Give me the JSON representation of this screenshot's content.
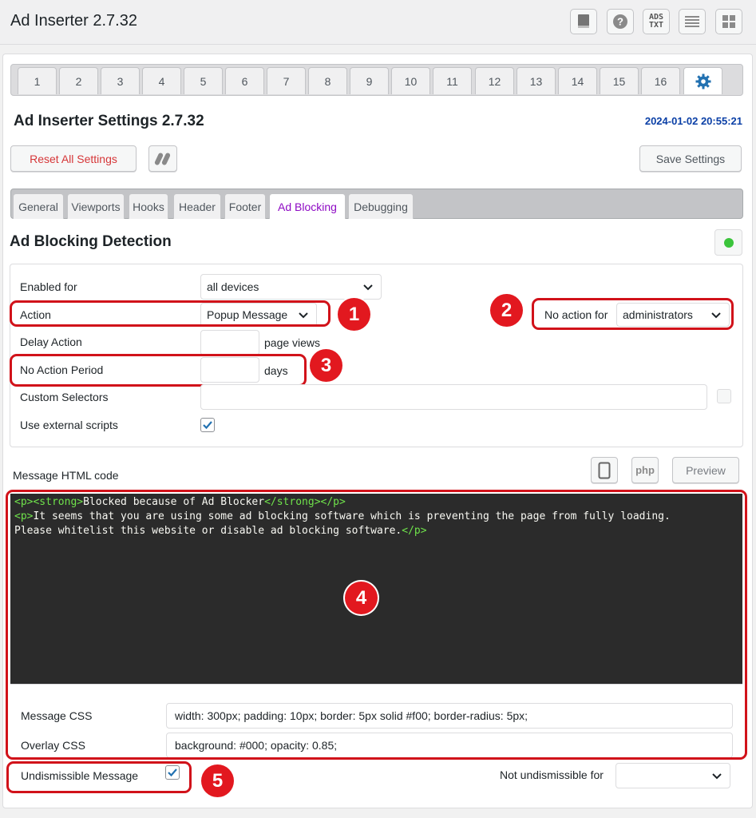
{
  "header": {
    "title": "Ad Inserter 2.7.32",
    "ads_txt_label": "ADS\nTXT",
    "icons": [
      "book-icon",
      "help-icon",
      "ads-txt-icon",
      "list-icon",
      "grid-icon"
    ]
  },
  "block_tabs": [
    "1",
    "2",
    "3",
    "4",
    "5",
    "6",
    "7",
    "8",
    "9",
    "10",
    "11",
    "12",
    "13",
    "14",
    "15",
    "16"
  ],
  "settings": {
    "title": "Ad Inserter Settings 2.7.32",
    "timestamp": "2024-01-02 20:55:21",
    "reset_label": "Reset All Settings",
    "save_label": "Save Settings"
  },
  "setting_tabs": [
    "General",
    "Viewports",
    "Hooks",
    "Header",
    "Footer",
    "Ad Blocking",
    "Debugging"
  ],
  "active_setting_tab": "Ad Blocking",
  "detection": {
    "title": "Ad Blocking Detection",
    "enabled_for_label": "Enabled for",
    "enabled_for_value": "all devices",
    "action_label": "Action",
    "action_value": "Popup Message",
    "no_action_for_label": "No action for",
    "no_action_for_value": "administrators",
    "delay_label": "Delay Action",
    "delay_value": "",
    "delay_unit": "page views",
    "period_label": "No Action Period",
    "period_value": "",
    "period_unit": "days",
    "selectors_label": "Custom Selectors",
    "selectors_value": "",
    "external_label": "Use external scripts",
    "external_checked": true
  },
  "message": {
    "label": "Message HTML code",
    "php_label": "php",
    "preview_label": "Preview",
    "code_lines": [
      [
        [
          "tag",
          "<p><strong>"
        ],
        [
          "txt",
          "Blocked because of Ad Blocker"
        ],
        [
          "tag",
          "</strong></p>"
        ]
      ],
      [
        [
          "tag",
          "<p>"
        ],
        [
          "txt",
          "It seems that you are using some ad blocking software which is preventing the page from fully loading."
        ]
      ],
      [
        [
          "txt",
          "Please whitelist this website or disable ad blocking software."
        ],
        [
          "tag",
          "</p>"
        ]
      ]
    ],
    "css_label": "Message CSS",
    "css_value": "width: 300px; padding: 10px; border: 5px solid #f00; border-radius: 5px;",
    "overlay_label": "Overlay CSS",
    "overlay_value": "background: #000; opacity: 0.85;",
    "undismissible_label": "Undismissible Message",
    "undismissible_checked": true,
    "not_undismissible_label": "Not undismissible for",
    "not_undismissible_value": ""
  },
  "markers": [
    "1",
    "2",
    "3",
    "4",
    "5"
  ],
  "colors": {
    "marker_red": "#e2181f",
    "accent_purple": "#8e0ac4",
    "timestamp_blue": "#0a3fa6",
    "status_green": "#3bc43b"
  }
}
